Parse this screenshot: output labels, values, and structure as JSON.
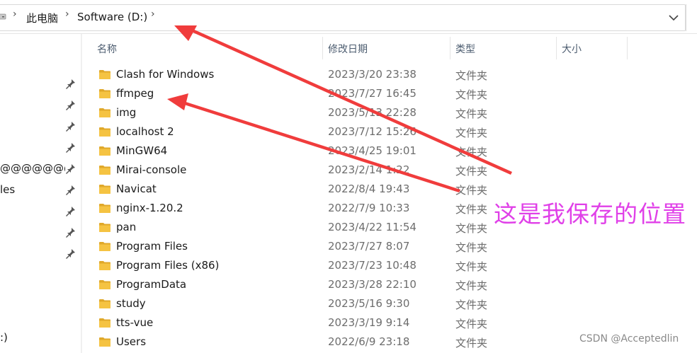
{
  "address_bar": {
    "crumbs": [
      "此电脑",
      "Software (D:)"
    ],
    "separator": "›"
  },
  "sidebar": {
    "items": [
      {
        "label": "",
        "pinned": true
      },
      {
        "label": "",
        "pinned": true
      },
      {
        "label": "",
        "pinned": true
      },
      {
        "label": "",
        "pinned": true
      },
      {
        "label": "@@@@@@@@",
        "pinned": true
      },
      {
        "label": "les",
        "pinned": true
      },
      {
        "label": "",
        "pinned": true
      },
      {
        "label": "",
        "pinned": true
      },
      {
        "label": "",
        "pinned": true
      }
    ],
    "drive_label": ":)"
  },
  "columns": {
    "name": "名称",
    "date": "修改日期",
    "type": "类型",
    "size": "大小"
  },
  "files": [
    {
      "name": "Clash for Windows",
      "date": "2023/3/20 23:38",
      "type": "文件夹"
    },
    {
      "name": "ffmpeg",
      "date": "2023/7/27 16:45",
      "type": "文件夹"
    },
    {
      "name": "img",
      "date": "2023/5/13 22:28",
      "type": "文件夹"
    },
    {
      "name": "localhost 2",
      "date": "2023/7/12 15:26",
      "type": "文件夹"
    },
    {
      "name": "MinGW64",
      "date": "2023/4/25 19:01",
      "type": "文件夹"
    },
    {
      "name": "Mirai-console",
      "date": "2023/2/14 1:22",
      "type": "文件夹"
    },
    {
      "name": "Navicat",
      "date": "2022/8/4 19:43",
      "type": "文件夹"
    },
    {
      "name": "nginx-1.20.2",
      "date": "2022/7/9 10:33",
      "type": "文件夹"
    },
    {
      "name": "pan",
      "date": "2023/4/22 11:54",
      "type": "文件夹"
    },
    {
      "name": "Program Files",
      "date": "2023/7/27 8:07",
      "type": "文件夹"
    },
    {
      "name": "Program Files (x86)",
      "date": "2023/7/23 10:48",
      "type": "文件夹"
    },
    {
      "name": "ProgramData",
      "date": "2023/3/28 22:10",
      "type": "文件夹"
    },
    {
      "name": "study",
      "date": "2023/5/16 9:30",
      "type": "文件夹"
    },
    {
      "name": "tts-vue",
      "date": "2023/3/19 9:14",
      "type": "文件夹"
    },
    {
      "name": "Users",
      "date": "2022/6/9 23:18",
      "type": "文件夹"
    }
  ],
  "annotation": {
    "text": "这是我保存的位置",
    "color": "#e040e8",
    "arrow_color": "#f03c3c"
  },
  "watermark": "CSDN @Acceptedlin",
  "colors": {
    "folder": "#f5c342",
    "folder_dark": "#e0a82a",
    "header_text": "#4d5d70"
  },
  "icons": {
    "pin": "pin-icon",
    "folder": "folder-icon",
    "dropdown": "chevron-down-icon",
    "drive": "drive-icon"
  }
}
